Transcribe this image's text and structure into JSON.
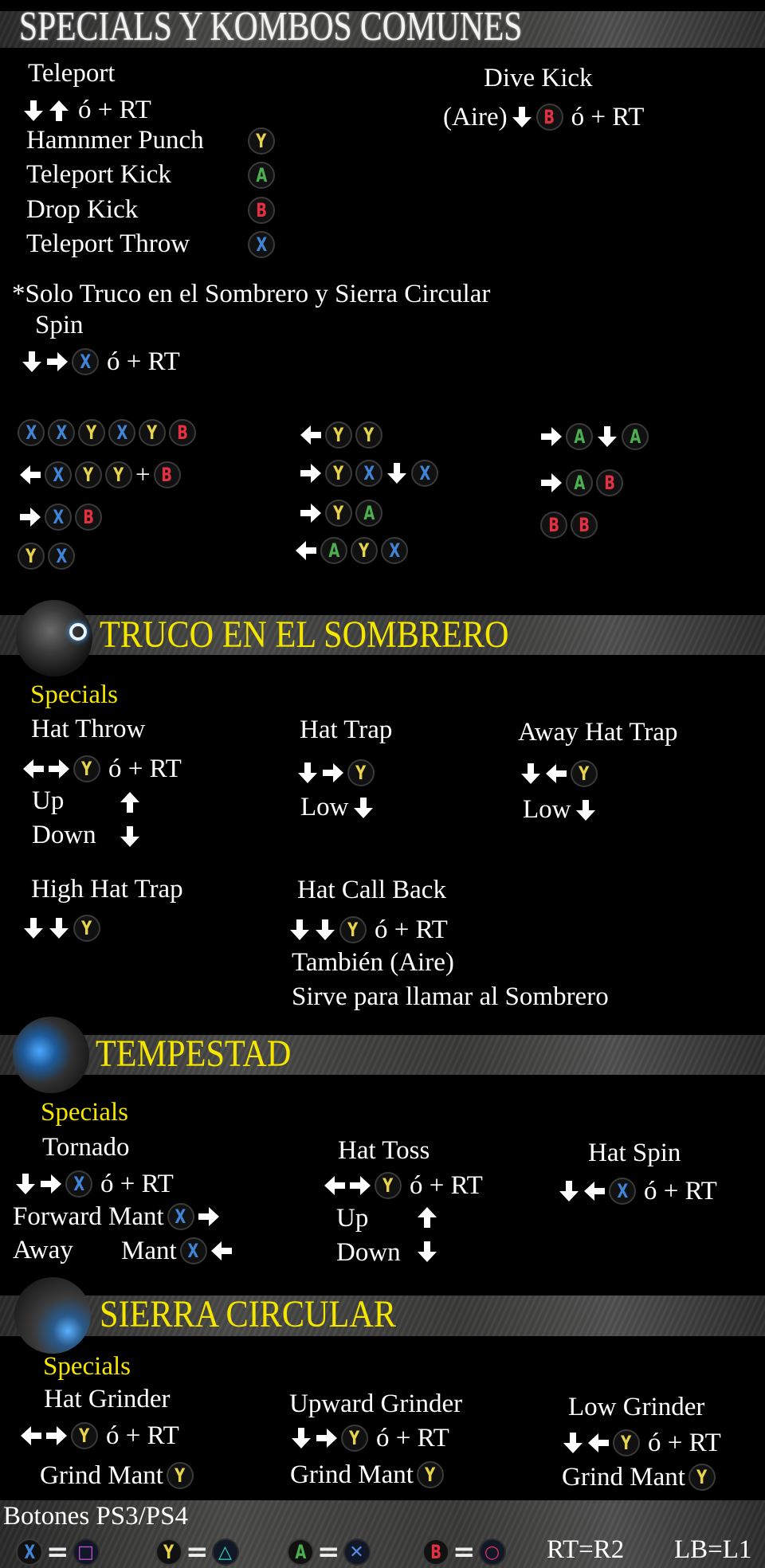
{
  "colors": {
    "X": "#3f86d8",
    "Y": "#e8d44a",
    "A": "#4cb050",
    "B": "#e23242",
    "section_title": "#f5e600"
  },
  "header": {
    "title": "SPECIALS Y KOMBOS COMUNES"
  },
  "common": {
    "teleport": {
      "name": "Teleport",
      "input": [
        "↓",
        "↑",
        "ó + RT"
      ]
    },
    "hammer_punch": {
      "name": "Hamnmer Punch",
      "button": "Y"
    },
    "teleport_kick": {
      "name": "Teleport Kick",
      "button": "A"
    },
    "drop_kick": {
      "name": "Drop Kick",
      "button": "B"
    },
    "teleport_throw": {
      "name": "Teleport Throw",
      "button": "X"
    },
    "dive_kick": {
      "name": "Dive Kick",
      "input": [
        "(Aire)",
        "↓",
        "B",
        "ó + RT"
      ]
    },
    "note": "*Solo Truco en el Sombrero y Sierra Circular",
    "spin": {
      "name": "Spin",
      "input": [
        "↓",
        "→",
        "X",
        "ó + RT"
      ]
    }
  },
  "combos": [
    [
      [
        "X",
        "X",
        "Y",
        "X",
        "Y",
        "B"
      ],
      [
        "←",
        "X",
        "Y",
        "Y",
        "+",
        "B"
      ],
      [
        "→",
        "X",
        "B"
      ],
      [
        "Y",
        "X"
      ]
    ],
    [
      [
        "←",
        "Y",
        "Y"
      ],
      [
        "→",
        "Y",
        "X",
        "↓",
        "X"
      ],
      [
        "→",
        "Y",
        "A"
      ],
      [
        "←",
        "A",
        "Y",
        "X"
      ]
    ],
    [
      [
        "→",
        "A",
        "↓",
        "A"
      ],
      [
        "→",
        "A",
        "B"
      ],
      [
        "B",
        "B"
      ]
    ]
  ],
  "truco": {
    "title": "TRUCO EN EL SOMBRERO",
    "specials_label": "Specials",
    "hat_throw": {
      "name": "Hat Throw",
      "input": [
        "←",
        "→",
        "Y",
        "ó + RT"
      ],
      "up": "Up",
      "up_input": [
        "↑"
      ],
      "down": "Down",
      "down_input": [
        "↓"
      ]
    },
    "hat_trap": {
      "name": "Hat Trap",
      "input": [
        "↓",
        "→",
        "Y"
      ],
      "low": [
        "Low",
        "↓"
      ]
    },
    "away_hat_trap": {
      "name": "Away Hat Trap",
      "input": [
        "↓",
        "←",
        "Y"
      ],
      "low": [
        "Low",
        "↓"
      ]
    },
    "high_hat_trap": {
      "name": "High Hat Trap",
      "input": [
        "↓",
        "↓",
        "Y"
      ]
    },
    "hat_call_back": {
      "name": "Hat Call Back",
      "input": [
        "↓",
        "↓",
        "Y",
        "ó + RT"
      ],
      "note1": "También (Aire)",
      "note2": "Sirve para llamar al Sombrero"
    }
  },
  "tempestad": {
    "title": "TEMPESTAD",
    "specials_label": "Specials",
    "tornado": {
      "name": "Tornado",
      "input": [
        "↓",
        "→",
        "X",
        "ó + RT"
      ],
      "forward": [
        "Forward Mant",
        "X",
        "→"
      ],
      "away_label": "Away",
      "away": [
        "Mant",
        "X",
        "←"
      ]
    },
    "hat_toss": {
      "name": "Hat Toss",
      "input": [
        "←",
        "→",
        "Y",
        "ó + RT"
      ],
      "up": "Up",
      "up_input": [
        "↑"
      ],
      "down": "Down",
      "down_input": [
        "↓"
      ]
    },
    "hat_spin": {
      "name": "Hat Spin",
      "input": [
        "↓",
        "←",
        "X",
        "ó + RT"
      ]
    }
  },
  "sierra": {
    "title": "SIERRA CIRCULAR",
    "specials_label": "Specials",
    "hat_grinder": {
      "name": "Hat Grinder",
      "input": [
        "←",
        "→",
        "Y",
        "ó + RT"
      ],
      "mant": [
        "Grind Mant",
        "Y"
      ]
    },
    "upward_grinder": {
      "name": "Upward Grinder",
      "input": [
        "↓",
        "→",
        "Y",
        "ó + RT"
      ],
      "mant": [
        "Grind Mant",
        "Y"
      ]
    },
    "low_grinder": {
      "name": "Low Grinder",
      "input": [
        "↓",
        "←",
        "Y",
        "ó + RT"
      ],
      "mant": [
        "Grind Mant",
        "Y"
      ]
    }
  },
  "footer": {
    "title": "Botones PS3/PS4",
    "mappings": [
      {
        "xbox": "X",
        "ps": "□",
        "ps_name": "square",
        "ps_color": "#d050d8"
      },
      {
        "xbox": "Y",
        "ps": "△",
        "ps_name": "triangle",
        "ps_color": "#30d8c8"
      },
      {
        "xbox": "A",
        "ps": "✕",
        "ps_name": "cross",
        "ps_color": "#5a8ae8"
      },
      {
        "xbox": "B",
        "ps": "○",
        "ps_name": "circle",
        "ps_color": "#e83060"
      }
    ],
    "rt": "RT=R2",
    "lb": "LB=L1"
  }
}
